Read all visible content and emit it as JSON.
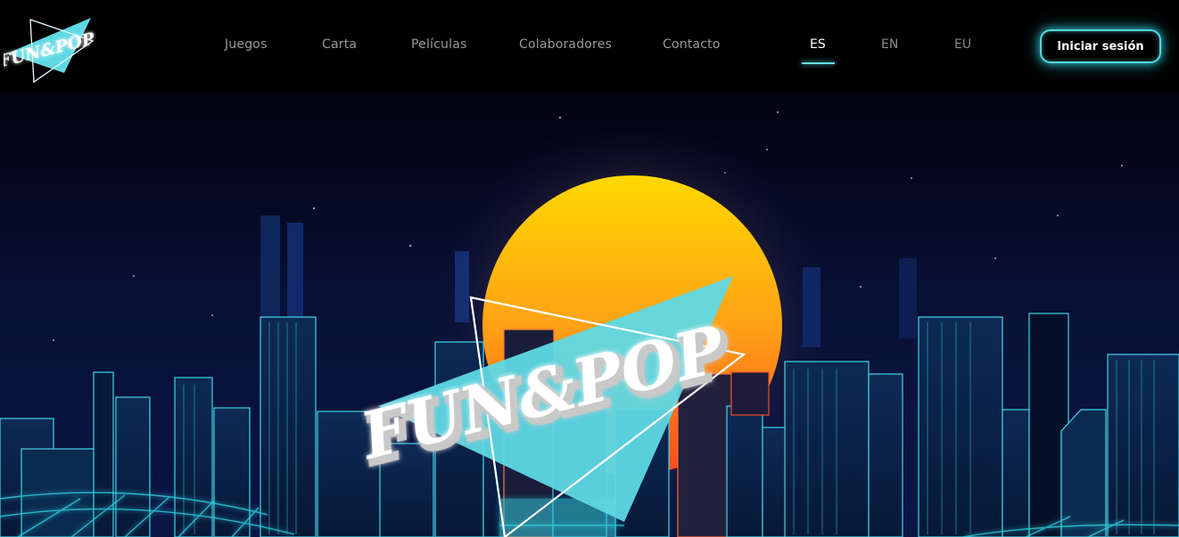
{
  "brand": {
    "logo_text": "FUN&POP"
  },
  "nav": {
    "links": [
      {
        "label": "Juegos"
      },
      {
        "label": "Carta"
      },
      {
        "label": "Películas"
      },
      {
        "label": "Colaboradores"
      },
      {
        "label": "Contacto"
      }
    ]
  },
  "languages": {
    "items": [
      {
        "label": "ES",
        "active": true
      },
      {
        "label": "EN",
        "active": false
      },
      {
        "label": "EU",
        "active": false
      }
    ]
  },
  "auth": {
    "login_label": "Iniciar sesión"
  },
  "hero": {
    "logo_text": "FUN&POP"
  },
  "colors": {
    "accent": "#57d6e0",
    "triangle": "#5fd8e4",
    "sun_top": "#ffd200",
    "sun_bottom": "#ff5a1a",
    "sky": "#0a1240",
    "building_line": "#3fd6e6"
  },
  "icons": {
    "logo": "funpop-triangle-logo"
  }
}
